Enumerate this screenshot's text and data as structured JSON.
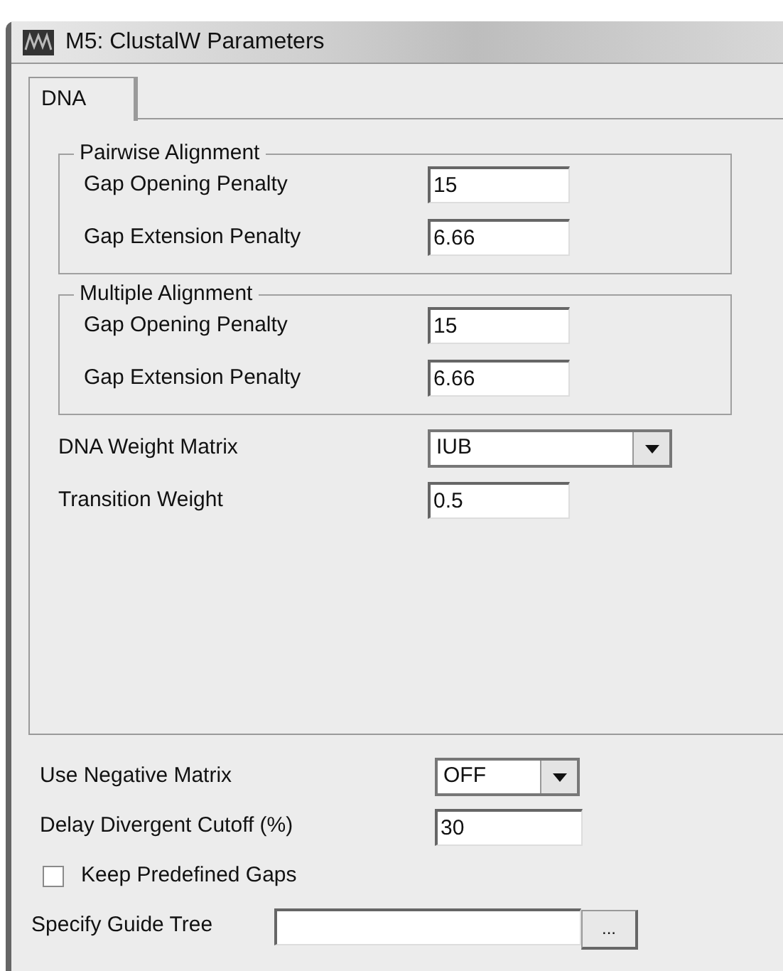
{
  "window": {
    "title": "M5: ClustalW Parameters"
  },
  "tabs": [
    {
      "label": "DNA",
      "selected": true
    }
  ],
  "groups": [
    {
      "title": "Pairwise Alignment",
      "fields": [
        {
          "label": "Gap Opening Penalty",
          "value": "15"
        },
        {
          "label": "Gap Extension Penalty",
          "value": "6.66"
        }
      ]
    },
    {
      "title": "Multiple Alignment",
      "fields": [
        {
          "label": "Gap Opening Penalty",
          "value": "15"
        },
        {
          "label": "Gap Extension Penalty",
          "value": "6.66"
        }
      ]
    }
  ],
  "dna_settings": [
    {
      "kind": "dropdown",
      "label": "DNA Weight Matrix",
      "value": "IUB"
    },
    {
      "kind": "text",
      "label": "Transition Weight",
      "value": "0.5"
    }
  ],
  "general_settings": [
    {
      "kind": "dropdown",
      "label": "Use Negative Matrix",
      "value": "OFF"
    },
    {
      "kind": "text",
      "label": "Delay Divergent Cutoff (%)",
      "value": "30"
    },
    {
      "kind": "checkbox",
      "label": "Keep Predefined Gaps",
      "checked": false
    },
    {
      "kind": "file",
      "label": "Specify Guide Tree",
      "button": "..."
    }
  ]
}
